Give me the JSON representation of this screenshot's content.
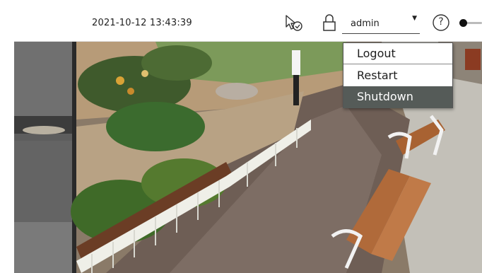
{
  "header": {
    "datetime": "2021-10-12 13:43:39",
    "user": "admin",
    "caret": "▼",
    "help": "?"
  },
  "icons": {
    "status": "cursor-check-icon",
    "lock": "lock-icon",
    "help": "help-icon",
    "toggle": "toggle-icon"
  },
  "user_menu": {
    "items": [
      {
        "label": "Logout"
      },
      {
        "label": "Restart"
      },
      {
        "label": "Shutdown",
        "selected": true
      }
    ]
  },
  "colors": {
    "menu_selected_bg": "#555b58",
    "menu_selected_text": "#ffffff"
  }
}
